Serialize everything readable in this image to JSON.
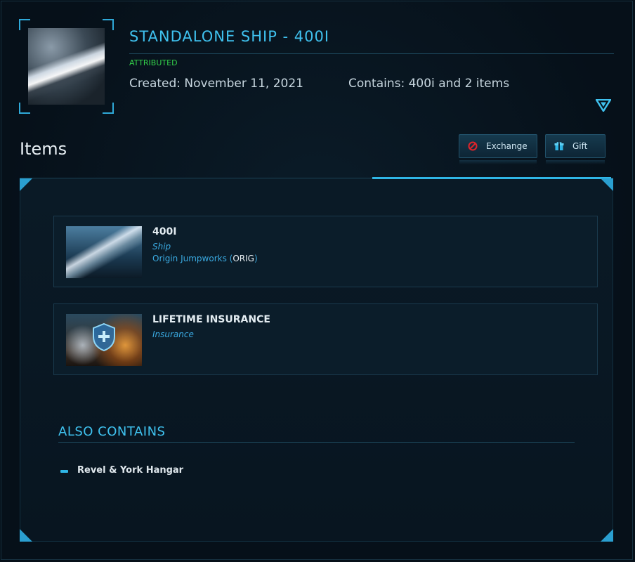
{
  "pledge": {
    "title": "STANDALONE SHIP - 400I",
    "status": "ATTRIBUTED",
    "created": "Created: November 11, 2021",
    "contains": "Contains: 400i and 2 items"
  },
  "items_section": {
    "heading": "Items",
    "exchange_label": "Exchange",
    "gift_label": "Gift"
  },
  "items": [
    {
      "name": "400I",
      "type": "Ship",
      "manufacturer": "Origin Jumpworks (",
      "manufacturer_code": "ORIG",
      "manufacturer_close": ")",
      "image": "400i-ship-thumbnail"
    },
    {
      "name": "LIFETIME INSURANCE",
      "type": "Insurance",
      "image": "insurance-shield-thumbnail"
    }
  ],
  "also_contains": {
    "title": "ALSO CONTAINS",
    "items": [
      "Revel & York Hangar"
    ]
  },
  "colors": {
    "accent": "#3fc1ee",
    "attributed": "#33d14a",
    "exchange_icon": "#e0242a",
    "gift_icon": "#2fb6e6"
  },
  "icons": {
    "expand": "triangle-down-icon",
    "exchange": "prohibited-icon",
    "gift": "gift-box-icon",
    "bullet": "dash-bullet-icon"
  }
}
